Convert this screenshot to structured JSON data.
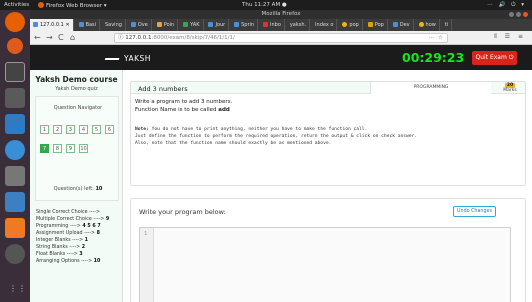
{
  "topbar": {
    "activities": "Activities",
    "app_menu": "Firefox Web Browser ▾",
    "clock": "Thu 11:27 AM ●",
    "tray": "⋯ 🔊 ⏻ ▾"
  },
  "window": {
    "title": "Mozilla Firefox"
  },
  "tabs": [
    {
      "label": "127.0.0.1 ✕",
      "active": true
    },
    {
      "label": "Basi"
    },
    {
      "label": "Saving"
    },
    {
      "label": "Ove"
    },
    {
      "label": "Poin"
    },
    {
      "label": "YAK"
    },
    {
      "label": "Jour"
    },
    {
      "label": "Sprin"
    },
    {
      "label": "Inbo"
    },
    {
      "label": "yaksh."
    },
    {
      "label": "Index o"
    },
    {
      "label": "pop"
    },
    {
      "label": "Pop"
    },
    {
      "label": "Dev"
    },
    {
      "label": "how"
    },
    {
      "label": "ti"
    }
  ],
  "nav": {
    "back": "←",
    "forward": "→",
    "reload": "C",
    "home": "⌂",
    "info_icon": "ⓘ",
    "url_host": "127.0.0.1",
    "url_path": ":8000/exam/8/skip/7/46/1/1/1/",
    "page_actions": "⋯  ☆",
    "library": "⫴ ☰ ≡"
  },
  "header": {
    "logo_text": "YAKSH",
    "timer": "00:29:23",
    "quit_label": "Quit Exam ⏻"
  },
  "sidebar": {
    "course_title": "Yaksh Demo course",
    "quiz_name": "Yaksh Demo quiz",
    "navigator_title": "Question Navigator",
    "question_numbers": [
      "1",
      "2",
      "3",
      "4",
      "5",
      "6",
      "7",
      "8",
      "9",
      "10"
    ],
    "current_question": "7",
    "questions_left_label": "Question(s) left:",
    "questions_left_value": "10",
    "categories": [
      {
        "label": "Single Correct Choice ---->",
        "value": ""
      },
      {
        "label": "Multiple Correct Choice ---->",
        "value": "9"
      },
      {
        "label": "Programming ---->",
        "value": "4 5 6 7"
      },
      {
        "label": "Assignment Upload ---->",
        "value": "8"
      },
      {
        "label": "Integer Blanks ---->",
        "value": "1"
      },
      {
        "label": "String Blanks ---->",
        "value": "2"
      },
      {
        "label": "Float Blanks ---->",
        "value": "3"
      },
      {
        "label": "Arranging Options ---->",
        "value": "10"
      }
    ]
  },
  "question": {
    "title": "Add 3 numbers",
    "type": "PROGRAMMING",
    "marks_value": "20",
    "marks_label": "Marks",
    "text_line1": "Write a program to add 3 numbers.",
    "text_line2_prefix": "Function Name is to be called ",
    "text_line2_bold": "add",
    "note_label": "Note:",
    "note_line1": " You do not have to print anything, neither you have to make the function call.",
    "note_line2": "Just define the function to perform the required operation, return the output & click on check answer.",
    "note_line3": "Also, note that the function name should exactly be as mentioned above."
  },
  "editor": {
    "label": "Write your program below:",
    "undo_label": "Undo Changes",
    "line_number": "1"
  },
  "colors": {
    "timer": "#13e81c",
    "quit": "#d9241b",
    "current_question": "#36a64f",
    "marks_badge": "#f0ad2b",
    "scroll_thumb": "#e8662c"
  }
}
